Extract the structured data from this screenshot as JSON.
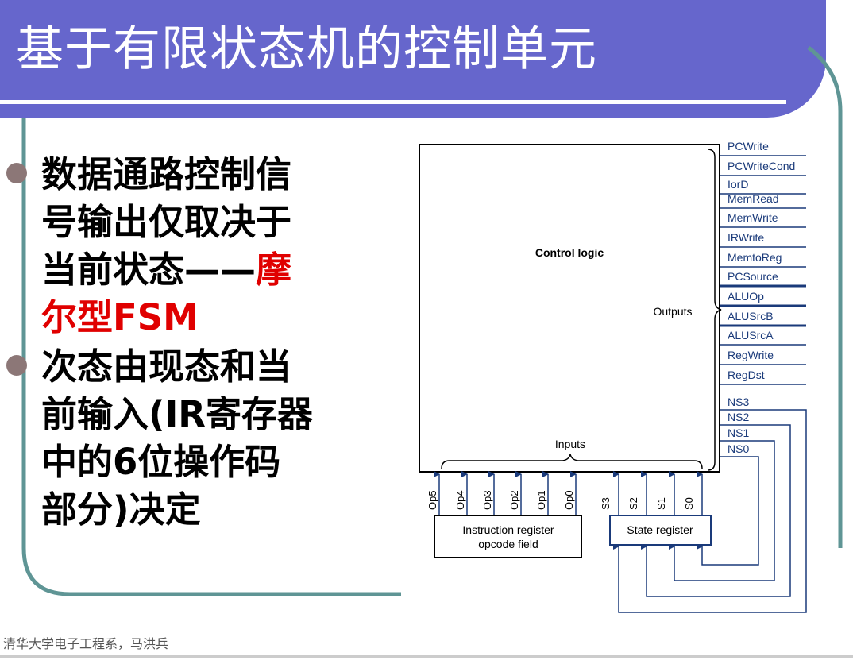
{
  "slide": {
    "title": "基于有限状态机的控制单元",
    "footer": "清华大学电子工程系，马洪兵"
  },
  "bullets": [
    {
      "lines": [
        "数据通路控制信",
        "号输出仅取决于"
      ],
      "line3_black": "当前状态——",
      "line3_red": "摩",
      "line4_red": "尔型FSM"
    },
    {
      "lines": [
        "次态由现态和当",
        "前输入(IR寄存器",
        "中的6位操作码",
        "部分)决定"
      ]
    }
  ],
  "diagram": {
    "control_logic_label": "Control logic",
    "outputs_label": "Outputs",
    "inputs_label": "Inputs",
    "output_signals": [
      "PCWrite",
      "PCWriteCond",
      "IorD",
      "MemRead",
      "MemWrite",
      "IRWrite",
      "MemtoReg",
      "PCSource",
      "ALUOp",
      "ALUSrcB",
      "ALUSrcA",
      "RegWrite",
      "RegDst"
    ],
    "next_state_signals": [
      "NS3",
      "NS2",
      "NS1",
      "NS0"
    ],
    "opcode_inputs": [
      "Op5",
      "Op4",
      "Op3",
      "Op2",
      "Op1",
      "Op0"
    ],
    "state_inputs": [
      "S3",
      "S2",
      "S1",
      "S0"
    ],
    "instruction_register_label_line1": "Instruction register",
    "instruction_register_label_line2": "opcode field",
    "state_register_label": "State register",
    "colors": {
      "wire": "#1a3a7a",
      "box_border": "#000000",
      "state_box_border": "#1a3a7a"
    }
  }
}
